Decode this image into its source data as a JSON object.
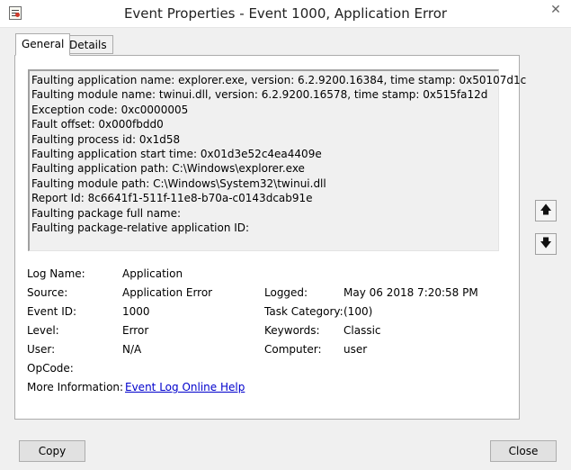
{
  "window": {
    "title": "Event Properties - Event 1000, Application Error",
    "close_glyph": "✕"
  },
  "tabs": [
    {
      "label": "General"
    },
    {
      "label": "Details"
    }
  ],
  "description_lines": [
    "Faulting application name: explorer.exe, version: 6.2.9200.16384, time stamp: 0x50107d1c",
    "Faulting module name: twinui.dll, version: 6.2.9200.16578, time stamp: 0x515fa12d",
    "Exception code: 0xc0000005",
    "Fault offset: 0x000fbdd0",
    "Faulting process id: 0x1d58",
    "Faulting application start time: 0x01d3e52c4ea4409e",
    "Faulting application path: C:\\Windows\\explorer.exe",
    "Faulting module path: C:\\Windows\\System32\\twinui.dll",
    "Report Id: 8c6641f1-511f-11e8-b70a-c0143dcab91e",
    "Faulting package full name:",
    "Faulting package-relative application ID:"
  ],
  "nav": {
    "up_icon": "arrow-up-icon",
    "down_icon": "arrow-down-icon",
    "up_glyph": "🡅",
    "down_glyph": "🡇"
  },
  "details": {
    "log_name_label": "Log Name:",
    "log_name": "Application",
    "source_label": "Source:",
    "source": "Application Error",
    "logged_label": "Logged:",
    "logged": "May 06 2018 7:20:58 PM",
    "event_id_label": "Event ID:",
    "event_id": "1000",
    "task_category_label": "Task Category:",
    "task_category": "(100)",
    "level_label": "Level:",
    "level": "Error",
    "keywords_label": "Keywords:",
    "keywords": "Classic",
    "user_label": "User:",
    "user": "N/A",
    "computer_label": "Computer:",
    "computer": "user",
    "opcode_label": "OpCode:",
    "more_info_label": "More Information:",
    "more_info_link": "Event Log Online Help"
  },
  "buttons": {
    "copy": "Copy",
    "close": "Close"
  }
}
